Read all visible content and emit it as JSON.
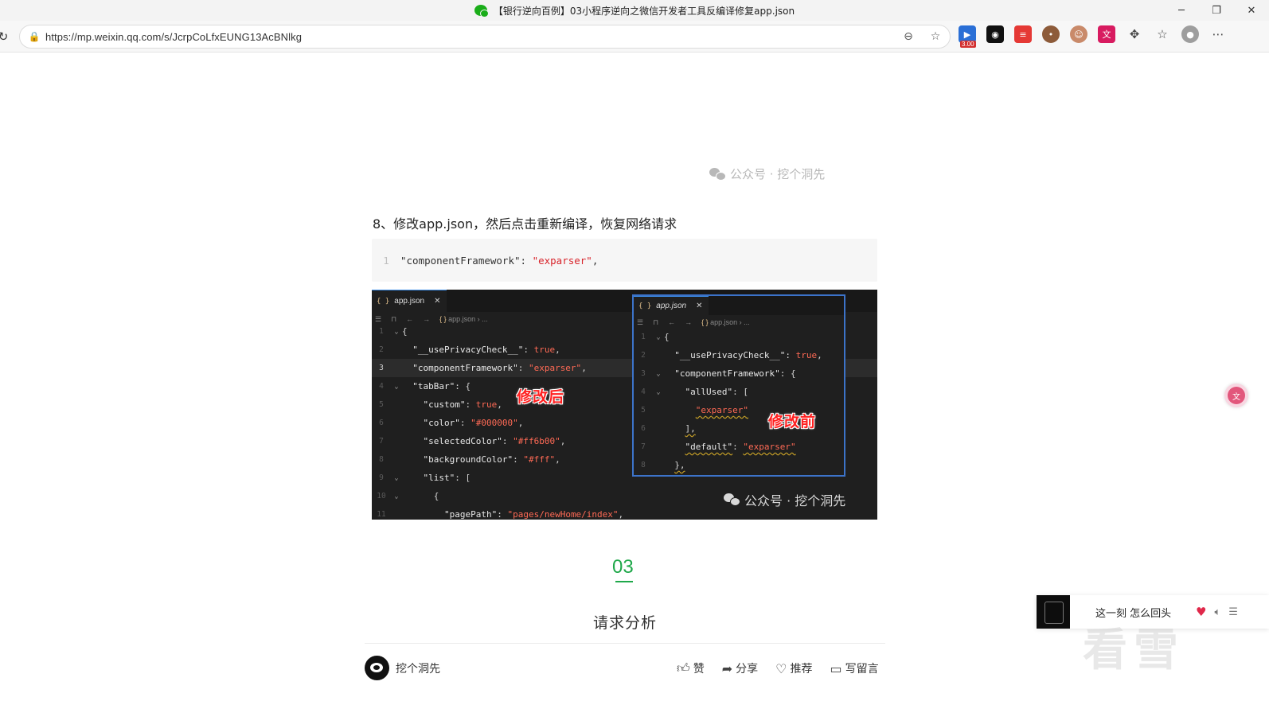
{
  "window": {
    "title": "【银行逆向百例】03小程序逆向之微信开发者工具反编译修复app.json",
    "controls": {
      "minimize": "─",
      "restore": "❐",
      "close": "✕"
    }
  },
  "toolbar": {
    "url": "https://mp.weixin.qq.com/s/JcrpCoLfxEUNG13AcBNlkg",
    "extension_badge": "3.00"
  },
  "article": {
    "watermark": "公众号 · 挖个洞先",
    "step_text": "8、修改app.json，然后点击重新编译，恢复网络请求",
    "code": {
      "line": "1",
      "key": "\"componentFramework\"",
      "sep": ": ",
      "value": "\"exparser\"",
      "tail": ","
    },
    "screenshot": {
      "tab_name": "app.json",
      "crumb": "app.json",
      "crumb_tail": "...",
      "after_lines": [
        {
          "n": "1",
          "text": "{"
        },
        {
          "n": "2",
          "key": "\"__usePrivacyCheck__\"",
          "val": "true",
          "tail": ","
        },
        {
          "n": "3",
          "key": "\"componentFramework\"",
          "val": "\"exparser\"",
          "tail": ","
        },
        {
          "n": "4",
          "key": "\"tabBar\"",
          "tail": ": {"
        },
        {
          "n": "5",
          "key": "\"custom\"",
          "val": "true",
          "tail": ","
        },
        {
          "n": "6",
          "key": "\"color\"",
          "val": "\"#000000\"",
          "tail": ","
        },
        {
          "n": "7",
          "key": "\"selectedColor\"",
          "val": "\"#ff6b00\"",
          "tail": ","
        },
        {
          "n": "8",
          "key": "\"backgroundColor\"",
          "val": "\"#fff\"",
          "tail": ","
        },
        {
          "n": "9",
          "key": "\"list\"",
          "tail": ": ["
        },
        {
          "n": "10",
          "text": "{"
        },
        {
          "n": "11",
          "key": "\"pagePath\"",
          "val": "\"pages/newHome/index\"",
          "tail": ","
        }
      ],
      "before_lines": [
        {
          "n": "1",
          "text": "{"
        },
        {
          "n": "2",
          "key": "\"__usePrivacyCheck__\"",
          "val": "true",
          "tail": ","
        },
        {
          "n": "3",
          "key": "\"componentFramework\"",
          "tail": ": {"
        },
        {
          "n": "4",
          "key": "\"allUsed\"",
          "tail": ": ["
        },
        {
          "n": "5",
          "val": "\"exparser\""
        },
        {
          "n": "6",
          "text": "],"
        },
        {
          "n": "7",
          "key": "\"default\"",
          "val": "\"exparser\""
        },
        {
          "n": "8",
          "text": "},"
        }
      ],
      "label_after": "修改后",
      "label_before": "修改前",
      "watermark": "公众号 · 挖个洞先"
    },
    "section_number": "03",
    "section_title": "请求分析"
  },
  "footer": {
    "author": "挖个洞先",
    "actions": {
      "like": "赞",
      "share": "分享",
      "recommend": "推荐",
      "comment": "写留言"
    }
  },
  "player": {
    "song": "这一刻 怎么回头"
  },
  "overlay_watermark": "看雪",
  "colors": {
    "accent_green": "#1fa84a",
    "code_string": "#d8232a",
    "stamp_red": "#ff2020"
  }
}
